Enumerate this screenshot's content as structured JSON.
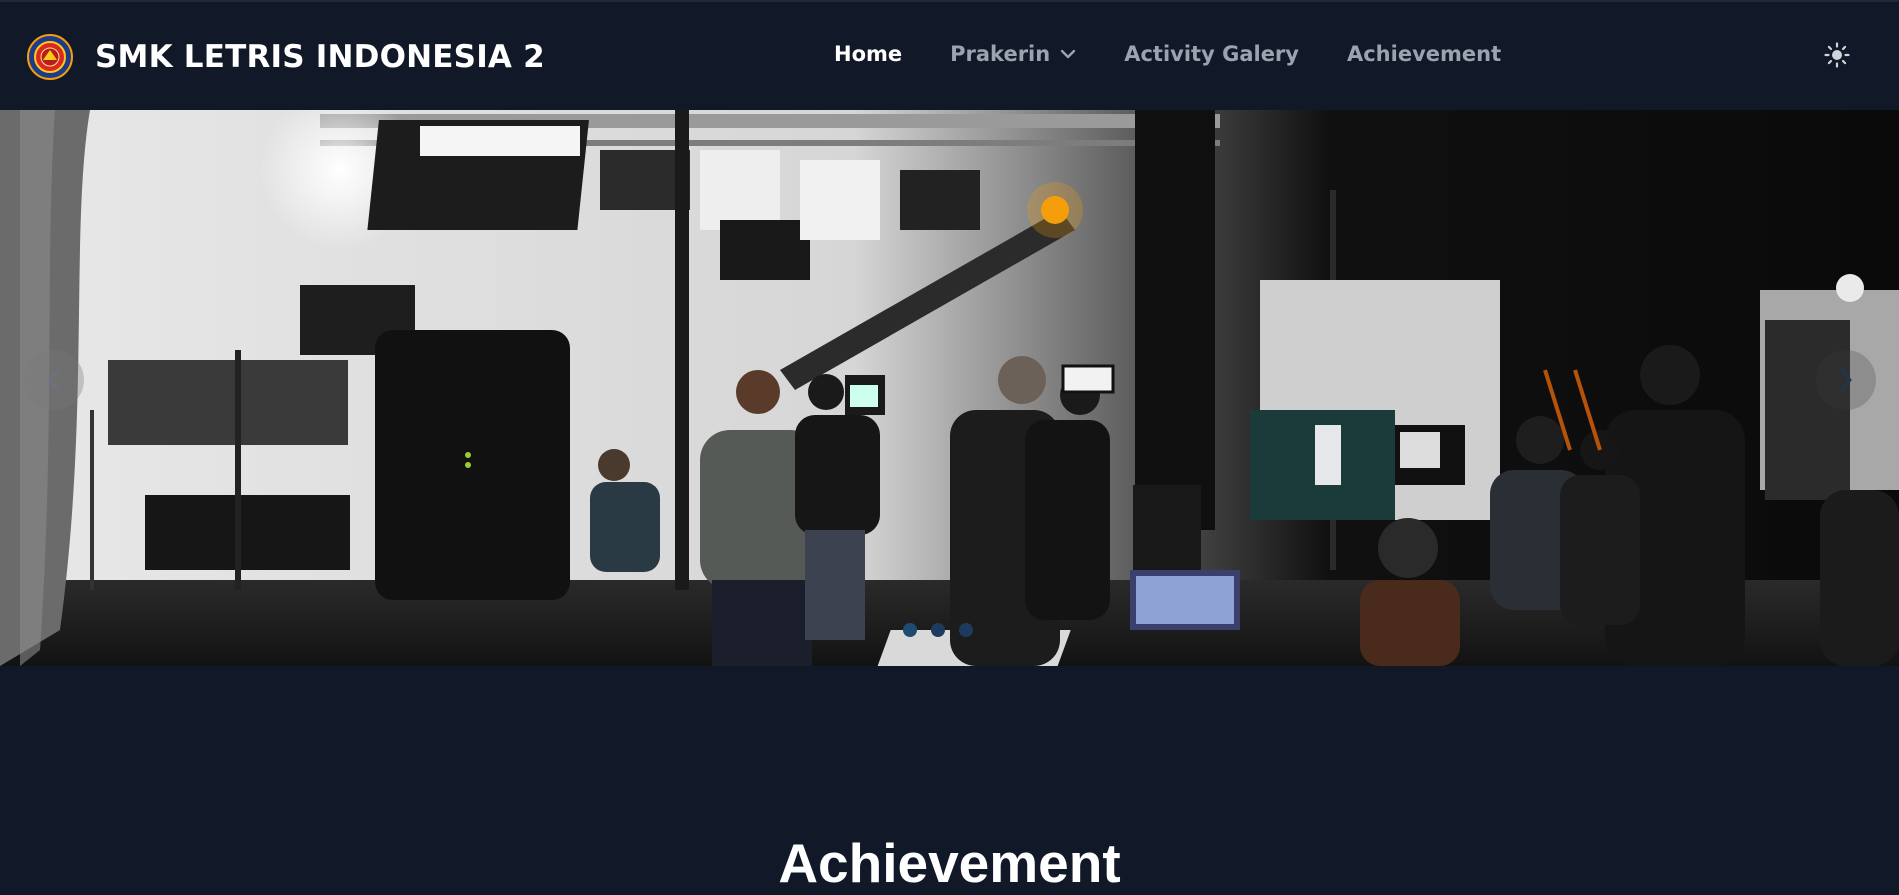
{
  "brand": {
    "title": "SMK LETRIS INDONESIA 2",
    "logo_icon": "school-emblem-icon"
  },
  "nav": {
    "items": [
      {
        "label": "Home",
        "active": true
      },
      {
        "label": "Prakerin",
        "has_dropdown": true
      },
      {
        "label": "Activity Galery"
      },
      {
        "label": "Achievement"
      }
    ]
  },
  "theme_toggle": {
    "icon": "sun-icon"
  },
  "hero": {
    "slides_count": 3,
    "active_slide": 1,
    "prev_icon": "chevron-left-icon",
    "next_icon": "chevron-right-icon"
  },
  "section": {
    "title": "Achievement"
  },
  "colors": {
    "background": "#111827",
    "nav_active": "#ffffff",
    "nav_inactive": "#9ca3af"
  }
}
